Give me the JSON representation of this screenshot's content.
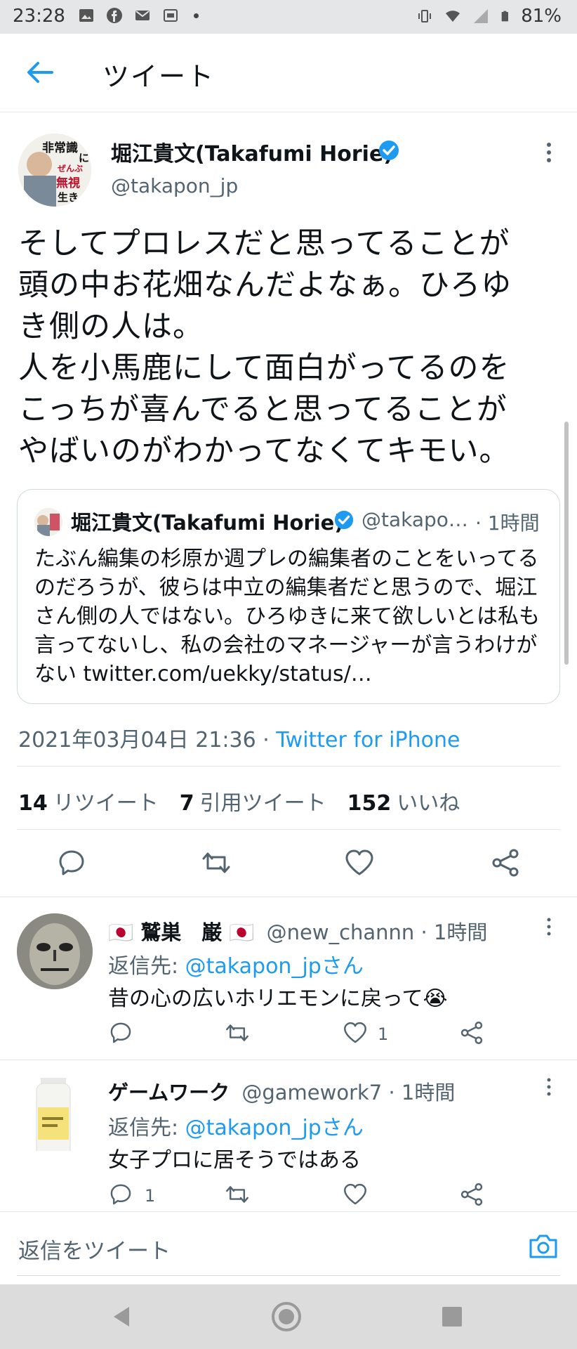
{
  "status_bar": {
    "time": "23:28",
    "battery": "81%"
  },
  "header": {
    "title": "ツイート"
  },
  "tweet": {
    "author_name": "堀江貴文(Takafumi Horie)",
    "author_handle": "@takapon_jp",
    "avatar_text": [
      "非常識",
      "に",
      "ぜんぶ",
      "無視",
      "生き"
    ],
    "text": "そしてプロレスだと思ってることが\n頭の中お花畑なんだよなぁ。ひろゆ\nき側の人は。\n人を小馬鹿にして面白がってるのを\nこっちが喜んでると思ってることが\nやばいのがわかってなくてキモい。",
    "quote": {
      "author_name": "堀江貴文(Takafumi Horie)",
      "author_handle": "@takapo…",
      "time": "· 1時間",
      "text": "たぶん編集の杉原か週プレの編集者のことをいってるのだろうが、彼らは中立の編集者だと思うので、堀江さん側の人ではない。ひろゆきに来て欲しいとは私も言ってないし、私の会社のマネージャーが言うわけがない twitter.com/uekky/status/…"
    },
    "timestamp": "2021年03月04日 21:36 · ",
    "client": "Twitter for iPhone",
    "stats": [
      {
        "count": "14",
        "label": "リツイート"
      },
      {
        "count": "7",
        "label": "引用ツイート"
      },
      {
        "count": "152",
        "label": "いいね"
      }
    ]
  },
  "replies": [
    {
      "name": "🇯🇵 鷲巣　巌 🇯🇵",
      "handle": "@new_channn",
      "time": "· 1時間",
      "reply_to_prefix": "返信先: ",
      "reply_to": "@takapon_jpさん",
      "text": "昔の心の広いホリエモンに戻って😭",
      "reply_count": "",
      "like_count": "1"
    },
    {
      "name": "ゲームワーク",
      "handle": "@gamework7",
      "time": "· 1時間",
      "reply_to_prefix": "返信先: ",
      "reply_to": "@takapon_jpさん",
      "text": "女子プロに居そうではある",
      "reply_count": "1",
      "like_count": ""
    }
  ],
  "composer": {
    "placeholder": "返信をツイート"
  },
  "colors": {
    "accent": "#1d9bf0",
    "text": "#0f1419",
    "secondary": "#536471"
  }
}
